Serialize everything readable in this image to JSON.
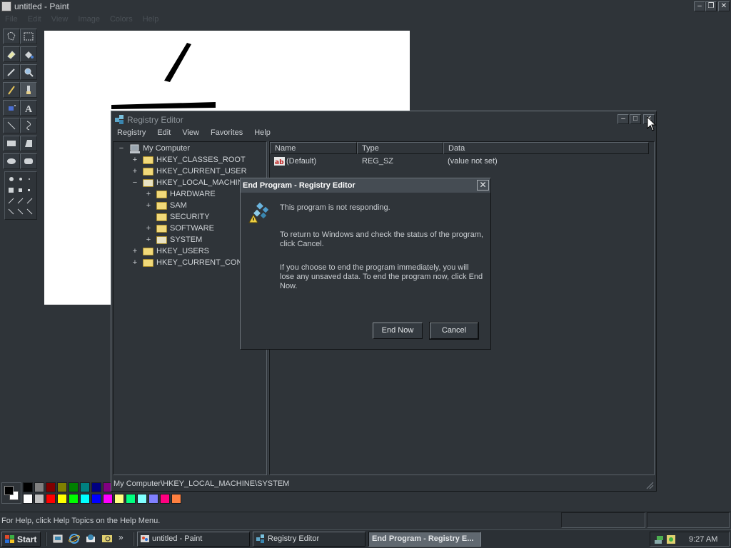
{
  "paint": {
    "title": "untitled - Paint",
    "menu": [
      "File",
      "Edit",
      "View",
      "Image",
      "Colors",
      "Help"
    ],
    "status": "For Help, click Help Topics on the Help Menu."
  },
  "palette": {
    "row1": [
      "#000000",
      "#808080",
      "#800000",
      "#808000",
      "#008000",
      "#008080",
      "#000080",
      "#800080"
    ],
    "row2": [
      "#ffffff",
      "#c0c0c0",
      "#ff0000",
      "#ffff00",
      "#00ff00",
      "#00ffff",
      "#0000ff",
      "#ff00ff",
      "#ffff80",
      "#00ff80",
      "#80ffff",
      "#8080ff",
      "#ff0080",
      "#ff8040"
    ]
  },
  "regedit": {
    "title": "Registry Editor",
    "menu": [
      "Registry",
      "Edit",
      "View",
      "Favorites",
      "Help"
    ],
    "tree": [
      {
        "label": "My Computer",
        "expander": "−"
      },
      {
        "label": "HKEY_CLASSES_ROOT",
        "expander": "+"
      },
      {
        "label": "HKEY_CURRENT_USER",
        "expander": "+"
      },
      {
        "label": "HKEY_LOCAL_MACHINE",
        "expander": "−"
      },
      {
        "label": "HARDWARE",
        "expander": "+"
      },
      {
        "label": "SAM",
        "expander": "+"
      },
      {
        "label": "SECURITY",
        "expander": ""
      },
      {
        "label": "SOFTWARE",
        "expander": "+"
      },
      {
        "label": "SYSTEM",
        "expander": "+"
      },
      {
        "label": "HKEY_USERS",
        "expander": "+"
      },
      {
        "label": "HKEY_CURRENT_CONFIG",
        "expander": "+"
      }
    ],
    "columns": [
      "Name",
      "Type",
      "Data"
    ],
    "rows": [
      {
        "name": "(Default)",
        "type": "REG_SZ",
        "data": "(value not set)"
      }
    ],
    "status": "My Computer\\HKEY_LOCAL_MACHINE\\SYSTEM"
  },
  "dialog": {
    "title": "End Program - Registry Editor",
    "close_glyph": "✕",
    "line1": "This program is not responding.",
    "para2": "To return to Windows and check the status of the program, click Cancel.",
    "para3": "If you choose to end the program immediately, you will lose any unsaved data. To end the program now, click End Now.",
    "end_now": "End Now",
    "cancel": "Cancel"
  },
  "taskbar": {
    "start": "Start",
    "quick_launch_more": "»",
    "tasks": [
      "untitled - Paint",
      "Registry Editor",
      "End Program - Registry E..."
    ],
    "clock": "9:27 AM"
  },
  "icons": {
    "paint_app": "paint-icon",
    "regedit_app": "regedit-icon",
    "dialog": "not-responding-icon",
    "value_string": "string-value-icon"
  }
}
